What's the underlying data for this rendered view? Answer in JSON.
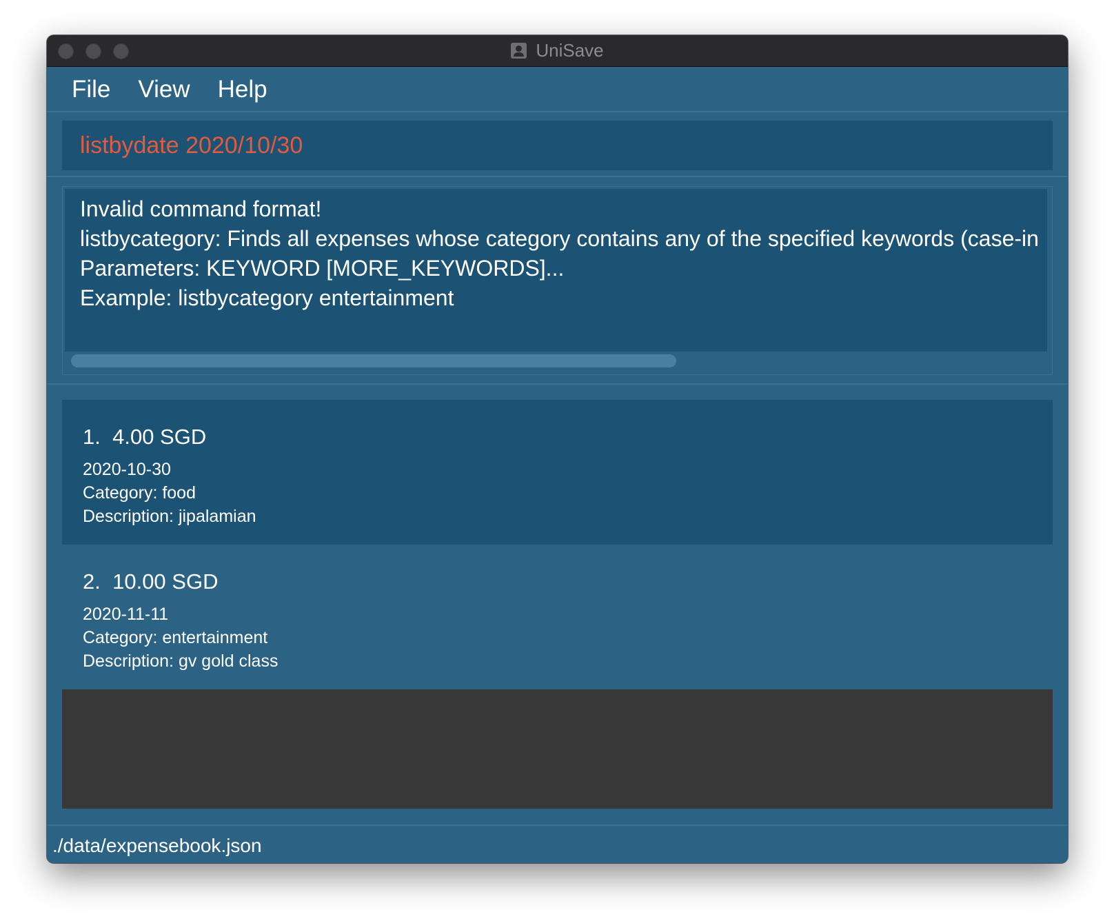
{
  "window": {
    "title": "UniSave"
  },
  "menu": {
    "items": [
      "File",
      "View",
      "Help"
    ]
  },
  "command_box": {
    "value": "listbydate 2020/10/30"
  },
  "result_display": {
    "lines": [
      "Invalid command format!",
      "listbycategory: Finds all expenses whose category contains any of the specified keywords (case-in",
      "Parameters: KEYWORD [MORE_KEYWORDS]...",
      "Example: listbycategory entertainment"
    ]
  },
  "expenses": [
    {
      "index": "1.",
      "amount": "4.00 SGD",
      "date": "2020-10-30",
      "category": "Category: food",
      "description": "Description: jipalamian"
    },
    {
      "index": "2.",
      "amount": "10.00 SGD",
      "date": "2020-11-11",
      "category": "Category: entertainment",
      "description": "Description: gv gold class"
    }
  ],
  "status_bar": {
    "path": "./data/expensebook.json"
  },
  "colors": {
    "background": "#2c6385",
    "panel": "#1c5273",
    "command_text": "#e35a3f",
    "list_empty": "#383838"
  }
}
